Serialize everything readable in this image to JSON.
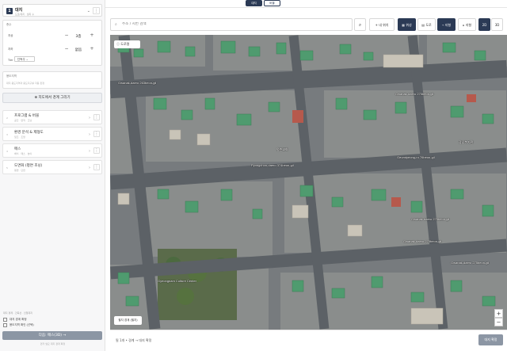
{
  "stepper": {
    "steps": [
      "대지",
      "버블",
      "",
      "",
      "",
      ""
    ],
    "active_index": 0,
    "current_index": 1
  },
  "sidebar": {
    "header": {
      "badge": "1",
      "title": "대지",
      "subtitle": "도로/대지 · 필지 수",
      "more": "⋮",
      "chevron": "⌄"
    },
    "floors_panel": {
      "label": "층수",
      "rows": [
        {
          "label": "지상",
          "value": "3층",
          "minus": "−",
          "plus": "+"
        },
        {
          "label": "지하",
          "value": "없음",
          "minus": "−",
          "plus": "+"
        }
      ],
      "use_label": "Tier",
      "use_select": "단독주 ⌄"
    },
    "boundary_panel": {
      "label": "용도지역",
      "hint": "대지 용도지역과 용도지구를 자동 판정"
    },
    "draw_button": "⊕ 지도에서 경계 그리기",
    "sections": [
      {
        "num": "2",
        "title": "프로그램 & 버블",
        "sub": "공간 · 면적 · 조닝",
        "chevron": "›",
        "more": "⋮"
      },
      {
        "num": "3",
        "title": "환경 분석 & 제형도",
        "sub": "일조 · 조망",
        "chevron": "›",
        "more": "⋮"
      },
      {
        "num": "4",
        "title": "매스",
        "sub": "배치 · 매스 · 높이",
        "chevron": "›",
        "more": "⋮"
      },
      {
        "num": "5",
        "title": "도면화 (평면 조닝)",
        "sub": "평면 · 단면",
        "chevron": "›",
        "more": "⋮"
      }
    ],
    "legend": "대지 경계 · 건축선 · 인접대지",
    "checks": [
      {
        "label": "대지 경계 확정"
      },
      {
        "label": "용도지역 확인 (선택)"
      }
    ],
    "next_button": "다음: 매스(3D) →",
    "next_hint": "먼저 필요 대지 경계 확정"
  },
  "toolbar": {
    "search_icon": "⌕",
    "search_placeholder": "주소 / 지번 검색",
    "search_go": "⌕",
    "my_location": "+ 내 위치",
    "satellite": "▦ 위성",
    "roadmap": "▤ 도로",
    "overlay": "⌁ 지형",
    "terrain": "⌂ 지형",
    "mode_2d": "2D",
    "mode_3d": "3D"
  },
  "map": {
    "road_btn": "ⓘ 도로명",
    "parcel_btn": "필지 경계 (필지)",
    "zoom_in": "+",
    "zoom_out": "−",
    "labels": [
      {
        "text": "Gwanak-daero 263beon-gil"
      },
      {
        "text": "Gwanak-daero 275beon-gil"
      },
      {
        "text": "Pyongchon-daero 374beon-gil"
      },
      {
        "text": "Geumtyeong-ro 76beon-gil"
      },
      {
        "text": "Gwanak-daero 275beon-gil"
      },
      {
        "text": "Gwanak-daero 275beon-gil"
      },
      {
        "text": "Gwanak-daero 275beon-gil"
      },
      {
        "text": "Gyeongnam Culture Center"
      },
      {
        "text": "광남복지관"
      },
      {
        "text": "평촌교회"
      }
    ]
  },
  "bottombar": {
    "status": "필 1개 • 경계 → 대지 확정",
    "confirm": "대지 확정"
  },
  "colors": {
    "navy": "#2b3a55",
    "roof_green": "#4f9b6f",
    "road": "#5c6166"
  }
}
